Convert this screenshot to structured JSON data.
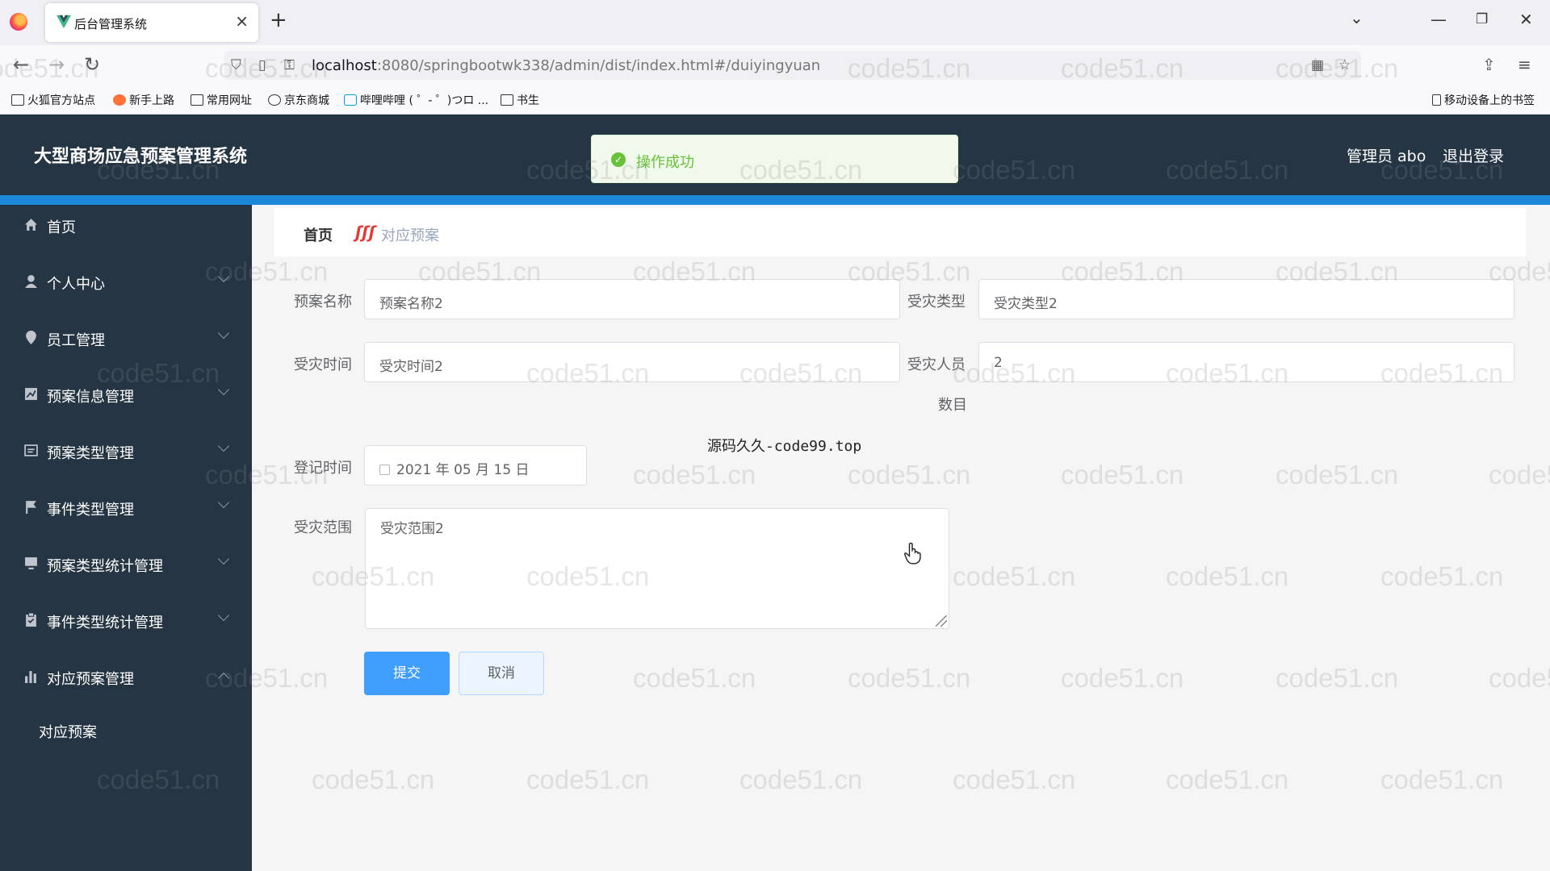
{
  "browser": {
    "tab_title": "后台管理系统",
    "url_host": "localhost",
    "url_rest": ":8080/springbootwk338/admin/dist/index.html#/duiyingyuan",
    "bookmarks": [
      "火狐官方站点",
      "新手上路",
      "常用网址",
      "京东商城",
      "哔哩哔哩 ( ゜- ゜)つロ ...",
      "书生"
    ],
    "mobile_bookmarks": "移动设备上的书签"
  },
  "header": {
    "title": "大型商场应急预案管理系统",
    "user": "管理员 abo",
    "logout": "退出登录"
  },
  "toast": {
    "text": "操作成功",
    "status_color": "#67c23a"
  },
  "sidebar": {
    "items": [
      {
        "label": "首页",
        "icon": "home-icon"
      },
      {
        "label": "个人中心",
        "icon": "user-icon"
      },
      {
        "label": "员工管理",
        "icon": "location-icon"
      },
      {
        "label": "预案信息管理",
        "icon": "chart-icon"
      },
      {
        "label": "预案类型管理",
        "icon": "card-icon"
      },
      {
        "label": "事件类型管理",
        "icon": "flag-icon"
      },
      {
        "label": "预案类型统计管理",
        "icon": "monitor-icon"
      },
      {
        "label": "事件类型统计管理",
        "icon": "clipboard-icon"
      },
      {
        "label": "对应预案管理",
        "icon": "bar-chart-icon"
      }
    ],
    "sub_item": "对应预案"
  },
  "breadcrumb": {
    "home": "首页",
    "current": "对应预案"
  },
  "form": {
    "plan_name": {
      "label": "预案名称",
      "value": "预案名称2"
    },
    "disaster_type": {
      "label": "受灾类型",
      "value": "受灾类型2"
    },
    "disaster_time": {
      "label": "受灾时间",
      "value": "受灾时间2"
    },
    "disaster_people": {
      "label": "受灾人员",
      "value": "2",
      "note": "数目"
    },
    "register_time": {
      "label": "登记时间",
      "value": "2021 年 05 月 15 日"
    },
    "disaster_scope": {
      "label": "受灾范围",
      "value": "受灾范围2"
    },
    "submit": "提交",
    "cancel": "取消"
  },
  "overlay_text": "源码久久-code99.top",
  "watermark": "code51.cn",
  "colors": {
    "header_bg": "#253544",
    "accent": "#409eff",
    "strip": "#1e88d8"
  }
}
